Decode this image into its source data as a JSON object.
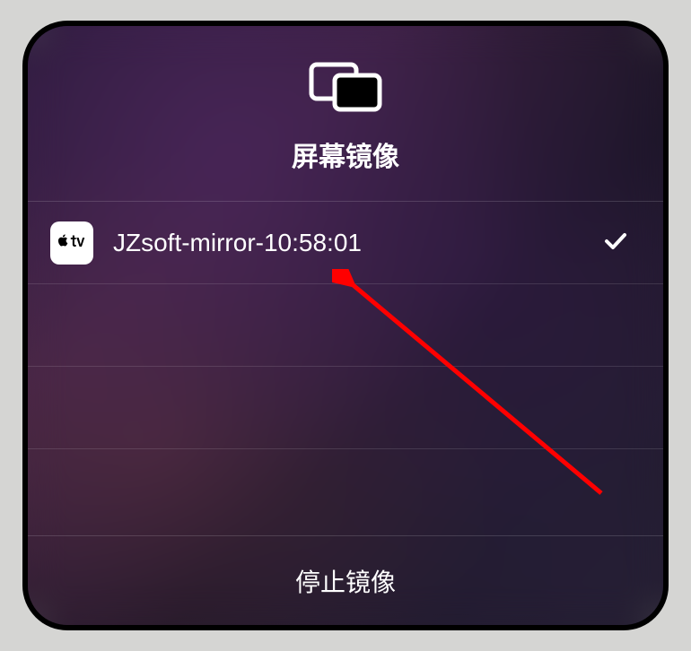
{
  "header": {
    "title": "屏幕镜像"
  },
  "devices": [
    {
      "name": "JZsoft-mirror-10:58:01",
      "selected": true,
      "icon": "apple-tv"
    }
  ],
  "footer": {
    "stop_label": "停止镜像"
  }
}
